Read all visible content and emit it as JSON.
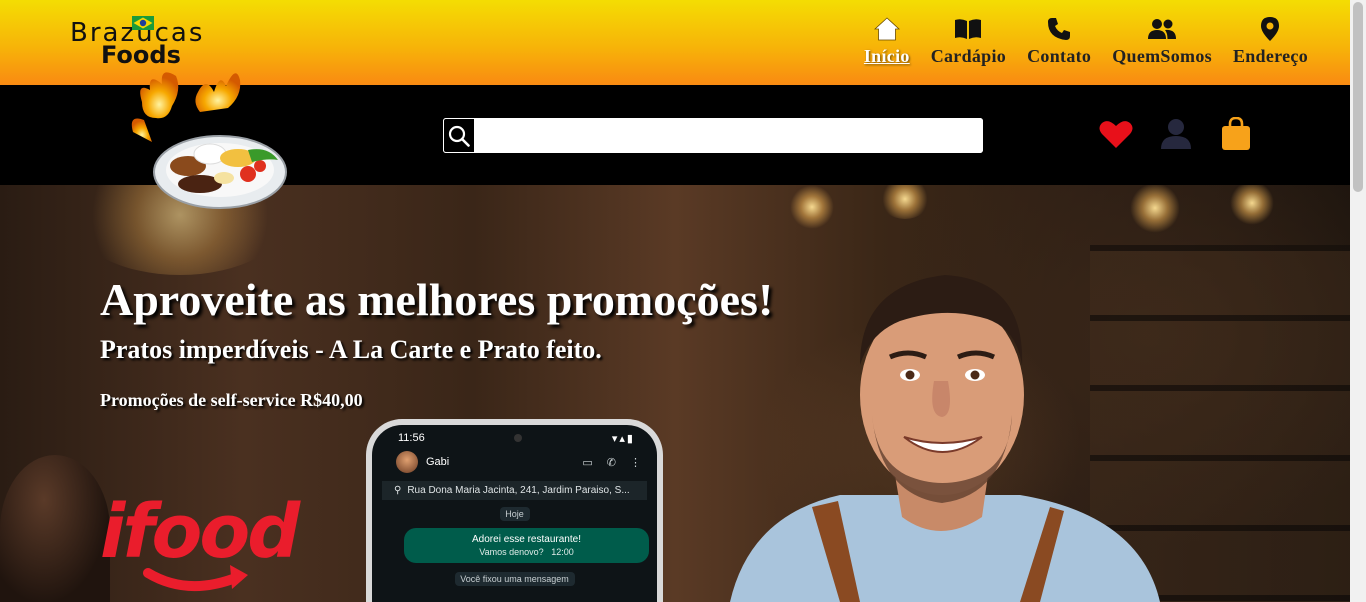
{
  "brand": {
    "line1": "Brazucas",
    "line2": "Foods"
  },
  "nav": [
    {
      "label": "Início",
      "icon": "home-icon",
      "active": true
    },
    {
      "label": "Cardápio",
      "icon": "book-icon",
      "active": false
    },
    {
      "label": "Contato",
      "icon": "phone-icon",
      "active": false
    },
    {
      "label": "QuemSomos",
      "icon": "people-icon",
      "active": false
    },
    {
      "label": "Endereço",
      "icon": "location-pin-icon",
      "active": false
    }
  ],
  "search": {
    "value": "",
    "placeholder": ""
  },
  "actions": [
    {
      "icon": "heart-icon",
      "color": "#e8101a"
    },
    {
      "icon": "user-icon",
      "color": "#26283e"
    },
    {
      "icon": "shopping-bag-icon",
      "color": "#f7a21a"
    }
  ],
  "hero": {
    "title": "Aproveite as melhores promoções!",
    "subtitle": "Pratos imperdíveis - A La Carte e Prato feito.",
    "promo": "Promoções de self-service R$40,00",
    "partner_logo": "ifood"
  },
  "phone": {
    "time": "11:56",
    "contact": "Gabi",
    "pinned_address": "Rua Dona Maria Jacinta, 241, Jardim Paraiso, S...",
    "day": "Hoje",
    "message": "Adorei esse restaurante!",
    "message_sub": "Vamos denovo?",
    "message_time": "12:00",
    "pinned_note": "Você fixou uma mensagem"
  },
  "colors": {
    "topbar_gradient_start": "#f4dd03",
    "topbar_gradient_end": "#f98a12",
    "ifood_red": "#ea1d2c",
    "whatsapp_green": "#005c4b"
  }
}
